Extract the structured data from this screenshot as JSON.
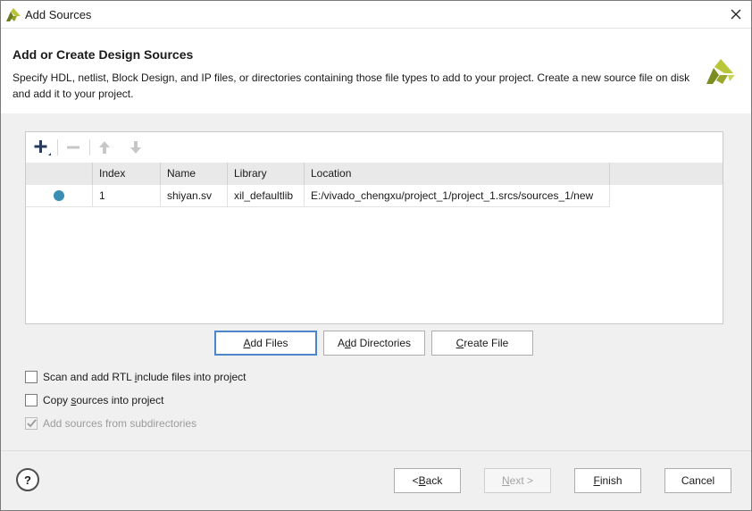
{
  "window": {
    "title": "Add Sources"
  },
  "header": {
    "title": "Add or Create Design Sources",
    "description": "Specify HDL, netlist, Block Design, and IP files, or directories containing those file types to add to your project. Create a new source file on disk and add it to your project."
  },
  "table": {
    "columns": [
      "",
      "Index",
      "Name",
      "Library",
      "Location"
    ],
    "rows": [
      {
        "index": "1",
        "name": "shiyan.sv",
        "library": "xil_defaultlib",
        "location": "E:/vivado_chengxu/project_1/project_1.srcs/sources_1/new"
      }
    ]
  },
  "actions": {
    "add_files": {
      "pre": "",
      "accel": "A",
      "post": "dd Files"
    },
    "add_directories": {
      "pre": "A",
      "accel": "d",
      "post": "d Directories"
    },
    "create_file": {
      "pre": "",
      "accel": "C",
      "post": "reate File"
    }
  },
  "options": {
    "scan_rtl": {
      "pre": "Scan and add RTL ",
      "accel": "i",
      "post": "nclude files into project",
      "checked": false
    },
    "copy_sources": {
      "pre": "Copy ",
      "accel": "s",
      "post": "ources into project",
      "checked": false
    },
    "add_subdirs": {
      "pre": "Add sources from subdirectories",
      "accel": "",
      "post": "",
      "checked": true,
      "disabled": true
    }
  },
  "footer": {
    "help": "?",
    "back": {
      "pre": "< ",
      "accel": "B",
      "post": "ack"
    },
    "next": {
      "pre": "",
      "accel": "N",
      "post": "ext >"
    },
    "finish": {
      "pre": "",
      "accel": "F",
      "post": "inish"
    },
    "cancel": "Cancel"
  },
  "colors": {
    "accent": "#4a86c8",
    "status_dot": "#3a8db3",
    "logo_green": "#a6b42a"
  },
  "icons": {
    "app": "vivado-logo-icon",
    "close": "close-icon",
    "add": "plus-icon",
    "remove": "minus-icon",
    "up": "arrow-up-icon",
    "down": "arrow-down-icon"
  }
}
